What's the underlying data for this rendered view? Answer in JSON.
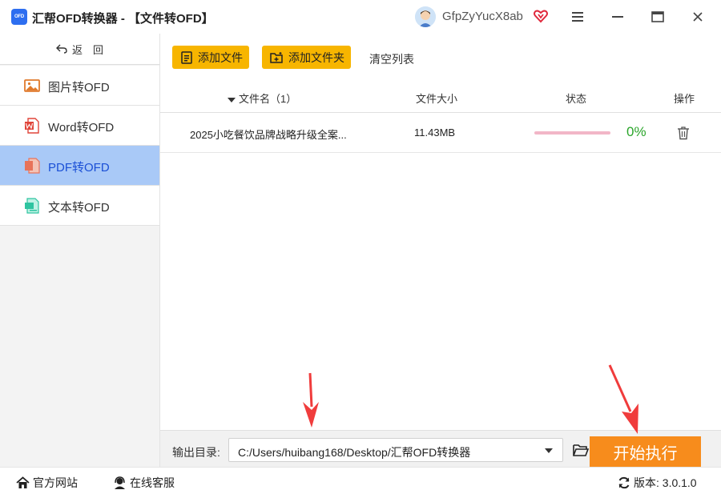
{
  "window": {
    "logo_text": "OFD",
    "title": "汇帮OFD转换器 - 【文件转OFD】",
    "username": "GfpZyYucX8ab"
  },
  "sidebar": {
    "back_label": "返　回",
    "items": [
      {
        "label": "图片转OFD",
        "icon": "image-icon",
        "active": false
      },
      {
        "label": "Word转OFD",
        "icon": "word-icon",
        "active": false
      },
      {
        "label": "PDF转OFD",
        "icon": "pdf-icon",
        "active": true
      },
      {
        "label": "文本转OFD",
        "icon": "text-file-icon",
        "active": false
      }
    ]
  },
  "toolbar": {
    "add_file_label": "添加文件",
    "add_folder_label": "添加文件夹",
    "clear_list_label": "清空列表"
  },
  "table": {
    "columns": {
      "name": "文件名（1）",
      "size": "文件大小",
      "status": "状态",
      "action": "操作"
    },
    "rows": [
      {
        "name": "2025小吃餐饮品牌战略升级全案...",
        "size": "11.43MB",
        "progress": 0,
        "percent_text": "0%"
      }
    ]
  },
  "output": {
    "label": "输出目录:",
    "path": "C:/Users/huibang168/Desktop/汇帮OFD转换器",
    "start_label": "开始执行"
  },
  "statusbar": {
    "site_label": "官方网站",
    "service_label": "在线客服",
    "version_label": "版本: 3.0.1.0"
  },
  "colors": {
    "accent_yellow": "#f7b500",
    "start_orange": "#f78c1c",
    "active_nav_bg": "#a9c9f7",
    "active_nav_text": "#1a4fd6",
    "progress_pink": "#f2b6c7",
    "percent_green": "#2aa52a",
    "annotation_red": "#f03c3c"
  }
}
